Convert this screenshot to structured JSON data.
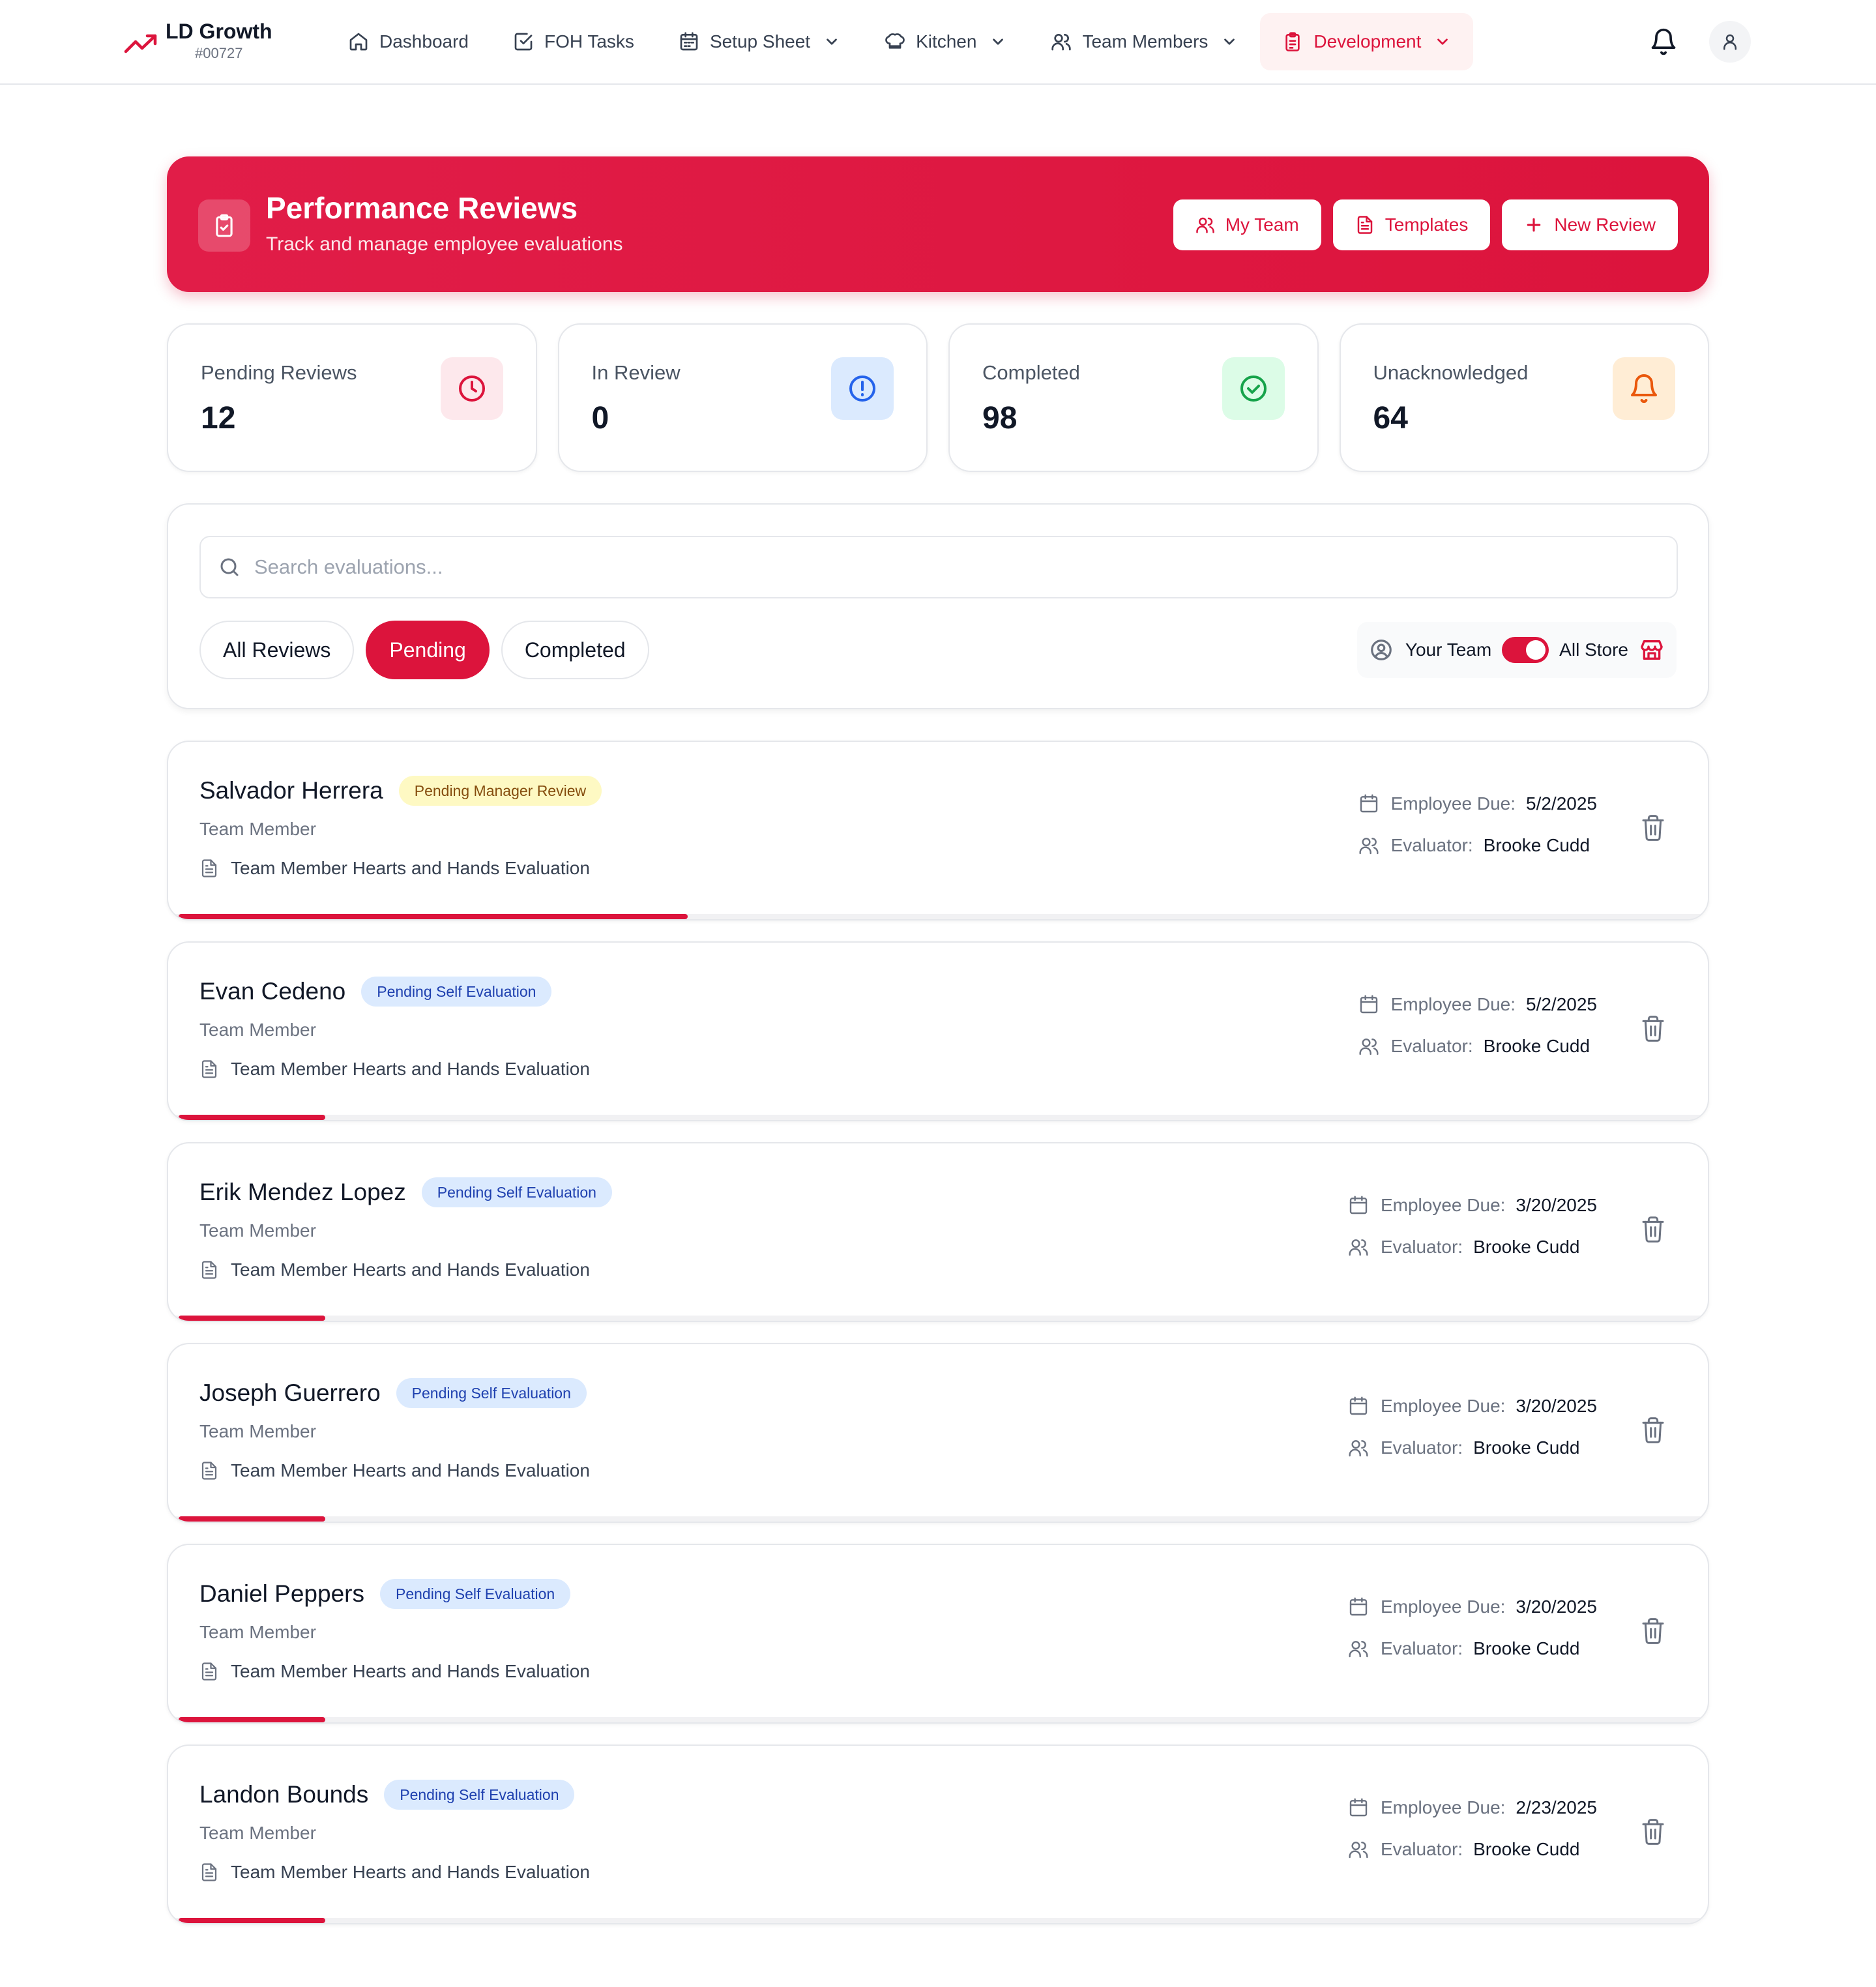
{
  "brand": {
    "name": "LD Growth",
    "id": "#00727",
    "accent": "#dc143c"
  },
  "nav": [
    {
      "label": "Dashboard",
      "icon": "home-icon",
      "dropdown": false
    },
    {
      "label": "FOH Tasks",
      "icon": "checkbox-icon",
      "dropdown": false
    },
    {
      "label": "Setup Sheet",
      "icon": "calendar-icon",
      "dropdown": true
    },
    {
      "label": "Kitchen",
      "icon": "chef-hat-icon",
      "dropdown": true
    },
    {
      "label": "Team Members",
      "icon": "users-icon",
      "dropdown": true
    },
    {
      "label": "Development",
      "icon": "clipboard-icon",
      "dropdown": true,
      "active": true
    }
  ],
  "hero": {
    "title": "Performance Reviews",
    "subtitle": "Track and manage employee evaluations",
    "buttons": {
      "my_team": "My Team",
      "templates": "Templates",
      "new_review": "New Review"
    }
  },
  "stats": [
    {
      "label": "Pending Reviews",
      "value": "12",
      "icon": "clock-icon",
      "color": "#dc143c",
      "bg": "#fde8ec"
    },
    {
      "label": "In Review",
      "value": "0",
      "icon": "alert-circle-icon",
      "color": "#2563eb",
      "bg": "#dbeafe"
    },
    {
      "label": "Completed",
      "value": "98",
      "icon": "check-circle-icon",
      "color": "#16a34a",
      "bg": "#dcfce7"
    },
    {
      "label": "Unacknowledged",
      "value": "64",
      "icon": "bell-icon",
      "color": "#ea580c",
      "bg": "#ffedd5"
    }
  ],
  "search": {
    "placeholder": "Search evaluations...",
    "value": ""
  },
  "tabs": [
    {
      "label": "All Reviews",
      "active": false
    },
    {
      "label": "Pending",
      "active": true
    },
    {
      "label": "Completed",
      "active": false
    }
  ],
  "scope": {
    "left_label": "Your Team",
    "right_label": "All Store",
    "all_store_on": true
  },
  "labels": {
    "employee_due": "Employee Due:",
    "evaluator": "Evaluator:"
  },
  "reviews": [
    {
      "name": "Salvador Herrera",
      "status": "Pending Manager Review",
      "status_type": "manager",
      "role": "Team Member",
      "template": "Team Member Hearts and Hands Evaluation",
      "due": "5/2/2025",
      "evaluator": "Brooke Cudd",
      "progress": 0.33
    },
    {
      "name": "Evan Cedeno",
      "status": "Pending Self Evaluation",
      "status_type": "self",
      "role": "Team Member",
      "template": "Team Member Hearts and Hands Evaluation",
      "due": "5/2/2025",
      "evaluator": "Brooke Cudd",
      "progress": 0.095
    },
    {
      "name": "Erik Mendez Lopez",
      "status": "Pending Self Evaluation",
      "status_type": "self",
      "role": "Team Member",
      "template": "Team Member Hearts and Hands Evaluation",
      "due": "3/20/2025",
      "evaluator": "Brooke Cudd",
      "progress": 0.095
    },
    {
      "name": "Joseph Guerrero",
      "status": "Pending Self Evaluation",
      "status_type": "self",
      "role": "Team Member",
      "template": "Team Member Hearts and Hands Evaluation",
      "due": "3/20/2025",
      "evaluator": "Brooke Cudd",
      "progress": 0.095
    },
    {
      "name": "Daniel Peppers",
      "status": "Pending Self Evaluation",
      "status_type": "self",
      "role": "Team Member",
      "template": "Team Member Hearts and Hands Evaluation",
      "due": "3/20/2025",
      "evaluator": "Brooke Cudd",
      "progress": 0.095
    },
    {
      "name": "Landon Bounds",
      "status": "Pending Self Evaluation",
      "status_type": "self",
      "role": "Team Member",
      "template": "Team Member Hearts and Hands Evaluation",
      "due": "2/23/2025",
      "evaluator": "Brooke Cudd",
      "progress": 0.095
    }
  ]
}
